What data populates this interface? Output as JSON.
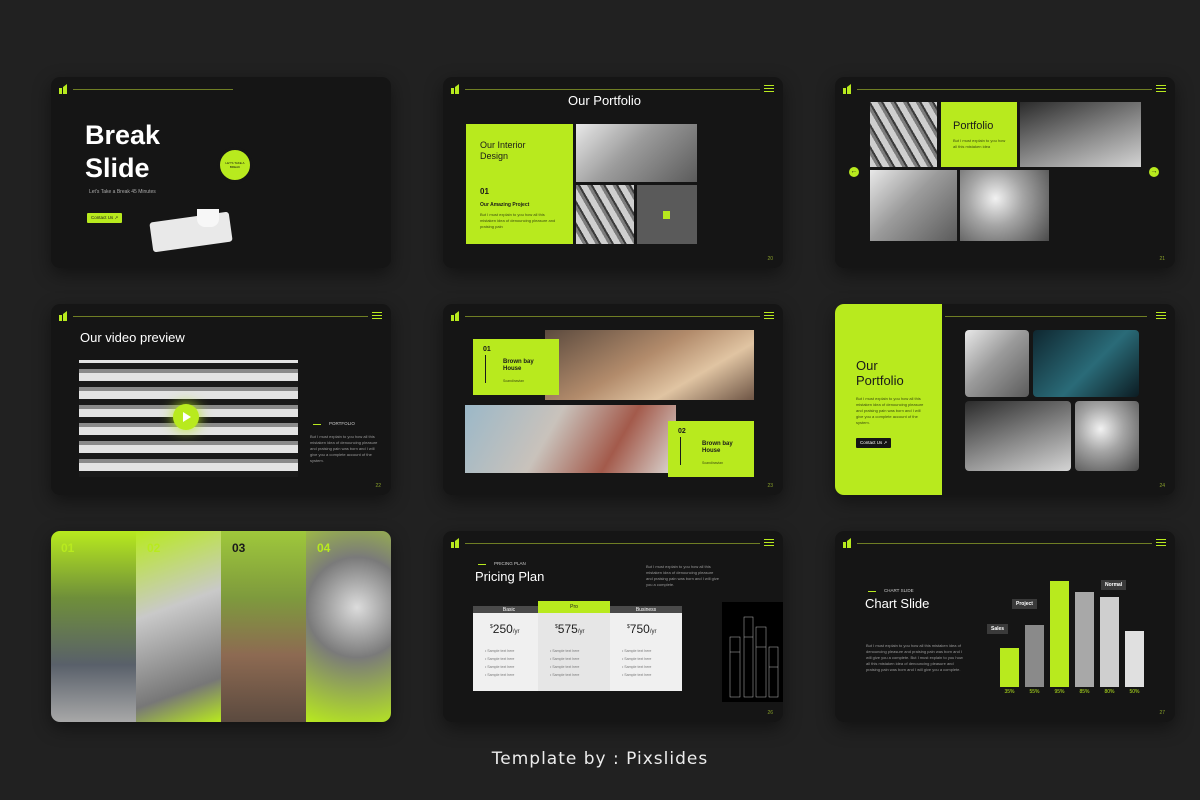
{
  "caption": "Template by : Pixslides",
  "colors": {
    "background": "#212121",
    "slide": "#151515",
    "accent": "#b8ea1e"
  },
  "slide1": {
    "title_line1": "Break",
    "title_line2": "Slide",
    "subtitle": "Let's Take a Break 45 Minutes",
    "button": "Contact Us",
    "badge": "LET'S TAKE A BREAK"
  },
  "slide2": {
    "title": "Our Portfolio",
    "card_title": "Our Interior Design",
    "number": "01",
    "project": "Our Amazing Project",
    "body": "But I must explain to you how all this mistaken idea of denouncing pleasure and praising pain",
    "page": "20"
  },
  "slide3": {
    "title": "Portfolio",
    "body": "But I must explain to you how all this mistaken idea",
    "page": "21"
  },
  "slide4": {
    "title": "Our video preview",
    "label": "PORTFOLIO",
    "body": "But I must explain to you how all this mistaken idea of denouncing pleasure and praising pain was born and I will give you a complete account of the system.",
    "page": "22"
  },
  "slide5": {
    "card1_num": "01",
    "card1_title": "Brown bay House",
    "card1_sub": "Scandinavian",
    "card2_num": "02",
    "card2_title": "Brown bay House",
    "card2_sub": "Scandinavian",
    "page": "23"
  },
  "slide6": {
    "title_line1": "Our",
    "title_line2": "Portfolio",
    "body": "But I must explain to you how all this mistaken idea of denouncing pleasure and praising pain was born and I will give you a complete account of the system.",
    "button": "Contact Us",
    "page": "24"
  },
  "slide7": {
    "numbers": [
      "01",
      "02",
      "03",
      "04"
    ]
  },
  "slide8": {
    "label": "PRICING PLAN",
    "title": "Pricing Plan",
    "desc": "But I must explain to you how all this mistaken idea of denouncing pleasure and praising pain was born and I will give you a complete.",
    "plans": [
      {
        "name": "Basic",
        "currency": "$",
        "price": "250",
        "per": "/yr"
      },
      {
        "name": "Pro",
        "currency": "$",
        "price": "575",
        "per": "/yr"
      },
      {
        "name": "Business",
        "currency": "$",
        "price": "750",
        "per": "/yr"
      }
    ],
    "features": [
      "Sample text here",
      "Sample text here",
      "Sample text here",
      "Sample text here"
    ],
    "page": "26"
  },
  "slide9": {
    "label": "CHART SLIDE",
    "title": "Chart Slide",
    "body": "But I must explain to you how all this mistaken idea of denouncing pleasure and praising pain was born and I will give you a complete. But I must explain to you how all this mistaken idea of denouncing pleasure and praising pain was born and I will give you a complete.",
    "tags": {
      "sales": "Sales",
      "project": "Project",
      "normal": "Normal"
    },
    "page": "27"
  },
  "chart_data": {
    "type": "bar",
    "categories": [
      "Sales",
      "",
      "Project",
      "",
      "Normal",
      ""
    ],
    "values": [
      35,
      55,
      95,
      85,
      80,
      50
    ],
    "labels": [
      "35%",
      "55%",
      "95%",
      "85%",
      "80%",
      "50%"
    ],
    "colors": [
      "#b8ea1e",
      "#8a8a8a",
      "#b8ea1e",
      "#a8a8a8",
      "#cfcfcf",
      "#e0e0e0"
    ],
    "ylim": [
      0,
      100
    ]
  }
}
